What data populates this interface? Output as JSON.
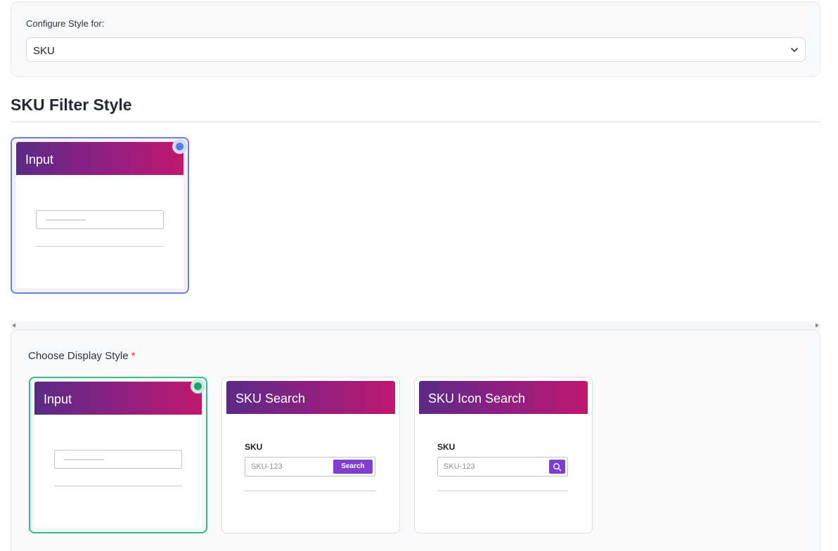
{
  "config": {
    "label": "Configure Style for:",
    "selected_value": "SKU"
  },
  "filter_section": {
    "title": "SKU Filter Style",
    "cards": [
      {
        "header": "Input",
        "selected": true
      }
    ]
  },
  "display_section": {
    "label": "Choose Display Style",
    "required_marker": "*",
    "cards": [
      {
        "header": "Input",
        "selected": true
      },
      {
        "header": "SKU Search",
        "field_label": "SKU",
        "placeholder": "SKU-123",
        "button_label": "Search"
      },
      {
        "header": "SKU Icon Search",
        "field_label": "SKU",
        "placeholder": "SKU-123",
        "button_icon": "search-icon"
      }
    ]
  },
  "colors": {
    "header_gradient_start": "#5b2a86",
    "header_gradient_end": "#c0186e",
    "button_purple": "#7e3fcf",
    "selected_blue": "#6b7fe0",
    "selected_green": "#3cb88a"
  }
}
